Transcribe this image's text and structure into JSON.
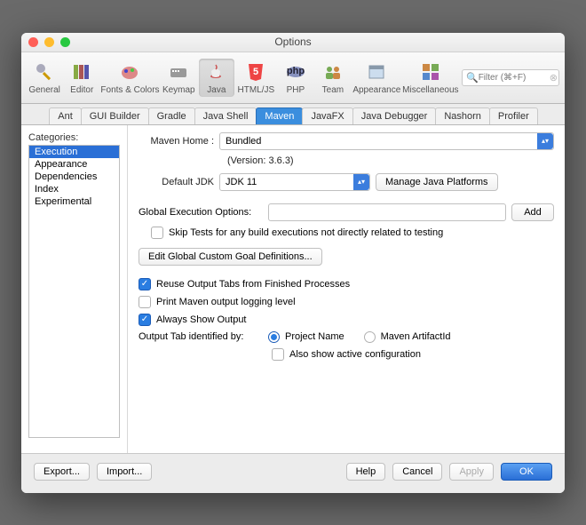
{
  "window": {
    "title": "Options"
  },
  "search": {
    "placeholder": "Filter (⌘+F)"
  },
  "toolbar": [
    {
      "label": "General"
    },
    {
      "label": "Editor"
    },
    {
      "label": "Fonts & Colors"
    },
    {
      "label": "Keymap"
    },
    {
      "label": "Java",
      "selected": true
    },
    {
      "label": "HTML/JS"
    },
    {
      "label": "PHP"
    },
    {
      "label": "Team"
    },
    {
      "label": "Appearance"
    },
    {
      "label": "Miscellaneous"
    }
  ],
  "tabs": [
    {
      "label": "Ant"
    },
    {
      "label": "GUI Builder"
    },
    {
      "label": "Gradle"
    },
    {
      "label": "Java Shell"
    },
    {
      "label": "Maven",
      "active": true
    },
    {
      "label": "JavaFX"
    },
    {
      "label": "Java Debugger"
    },
    {
      "label": "Nashorn"
    },
    {
      "label": "Profiler"
    }
  ],
  "categories": {
    "header": "Categories:",
    "items": [
      "Execution",
      "Appearance",
      "Dependencies",
      "Index",
      "Experimental"
    ],
    "selected": "Execution"
  },
  "form": {
    "mavenHomeLabel": "Maven Home :",
    "mavenHomeValue": "Bundled",
    "versionText": "(Version: 3.6.3)",
    "defaultJdkLabel": "Default JDK",
    "defaultJdkValue": "JDK 11",
    "managePlatforms": "Manage Java Platforms",
    "globalExecLabel": "Global Execution Options:",
    "globalExecValue": "",
    "addBtn": "Add",
    "skipTests": {
      "label": "Skip Tests for any build executions not directly related to testing",
      "checked": false
    },
    "editGlobalBtn": "Edit Global Custom Goal Definitions...",
    "reuseOutput": {
      "label": "Reuse Output Tabs from Finished Processes",
      "checked": true
    },
    "printLogging": {
      "label": "Print Maven output logging level",
      "checked": false
    },
    "alwaysShow": {
      "label": "Always Show Output",
      "checked": true
    },
    "outputTabLabel": "Output Tab identified by:",
    "radioProject": "Project Name",
    "radioArtifact": "Maven ArtifactId",
    "alsoShowConfig": {
      "label": "Also show active configuration",
      "checked": false
    }
  },
  "footer": {
    "export": "Export...",
    "import": "Import...",
    "help": "Help",
    "cancel": "Cancel",
    "apply": "Apply",
    "ok": "OK"
  }
}
